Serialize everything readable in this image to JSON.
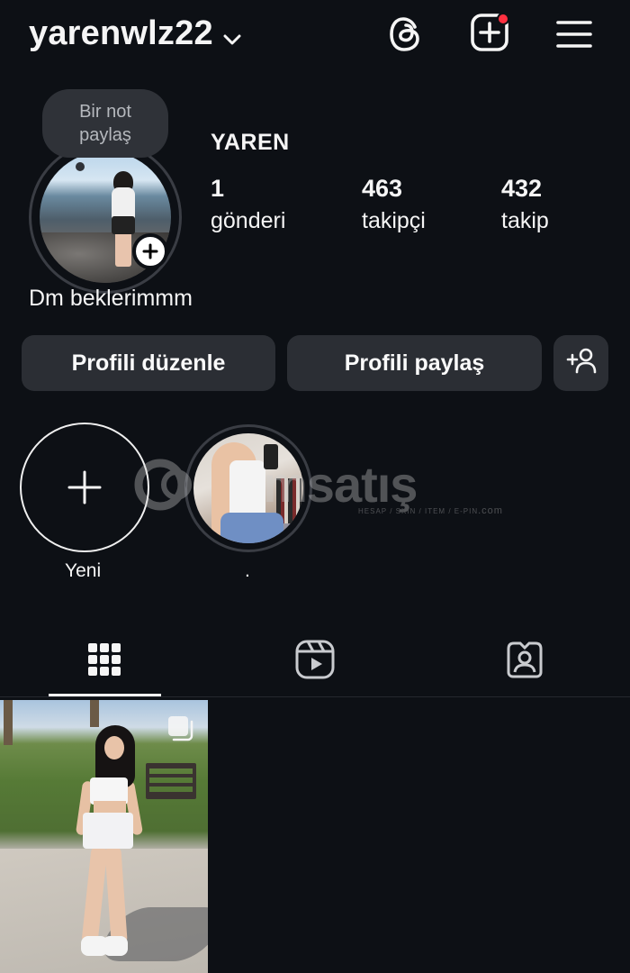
{
  "header": {
    "username": "yarenwlz22",
    "icons": [
      "chevron-down-icon",
      "threads-icon",
      "create-post-icon",
      "menu-icon"
    ],
    "create_badge_color": "#ff3040"
  },
  "profile": {
    "note_text": "Bir not paylaş",
    "display_name": "YAREN",
    "stats": {
      "posts": {
        "value": "1",
        "label": "gönderi"
      },
      "followers": {
        "value": "463",
        "label": "takipçi"
      },
      "following": {
        "value": "432",
        "label": "takip"
      }
    },
    "bio": "Dm beklerimmm"
  },
  "actions": {
    "edit_profile": "Profili düzenle",
    "share_profile": "Profili paylaş",
    "discover_people_icon": "add-person-icon"
  },
  "highlights": {
    "new_label": "Yeni",
    "items": [
      {
        "label": "."
      }
    ]
  },
  "watermark": {
    "text": "msatış",
    "subtext": "HESAP / SKIN / ITEM / E-PIN",
    "domain": ".com"
  },
  "tabs": {
    "items": [
      "grid-icon",
      "reels-icon",
      "tagged-icon"
    ],
    "active": 0
  },
  "colors": {
    "background": "#0d1015",
    "button": "#2b2e34",
    "text": "#f5f5f5",
    "accent_red": "#ff3040"
  }
}
